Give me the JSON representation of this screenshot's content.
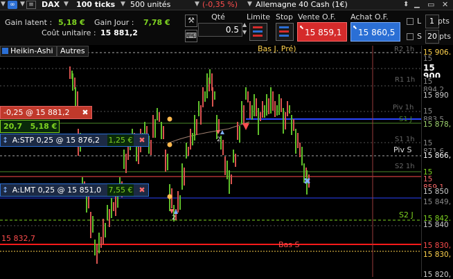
{
  "topbar": {
    "instrument": "DAX",
    "ticks": "100 ticks",
    "units": "500 unités",
    "change": "(-0,35 %)",
    "market": "Allemagne 40 Cash (1€)",
    "colors": {
      "change": "#ff4d4d"
    }
  },
  "info": {
    "gain_latent_label": "Gain latent :",
    "gain_latent_value": "5,18 €",
    "gain_jour_label": "Gain Jour :",
    "gain_jour_value": "7,78 €",
    "cout_label": "Coût unitaire :",
    "cout_value": "15 881,2"
  },
  "order": {
    "qte_label": "Qté",
    "qte_value": "0.5",
    "limite_label": "Limite",
    "stop_label": "Stop",
    "vente_label": "Vente O.F.",
    "vente_price": "15 859,1",
    "achat_label": "Achat O.F.",
    "achat_price": "15 860,5",
    "l_label": "L",
    "l_value": "1",
    "l_unit": "pts",
    "s_label": "S",
    "s_value": "20",
    "s_unit": "pts"
  },
  "chart_tabs": {
    "tab1": "Heikin-Ashi",
    "tab2": "Autres"
  },
  "position": {
    "label": "-0,25 @ 15 881,2",
    "qty": "20,7",
    "gain": "5,18 €"
  },
  "stop_order": {
    "label": "A:STP  0,25 @ 15 876,2",
    "value": "1,25 €"
  },
  "limit_order": {
    "label": "A:LMT  0,25 @ 15 851,0",
    "value": "7,55 €"
  },
  "annotations": {
    "bas_j_pre": "Bas J. Pré)",
    "bas": "Bas S",
    "price_left": "15 832,7",
    "piv_s": "Piv S",
    "s2_j": "S2 J",
    "marker_2a": "2",
    "marker_2b": "2"
  },
  "price_scale": [
    {
      "text": "15 906,",
      "color": "#ffd24d",
      "bg": "#000"
    },
    {
      "text": "15 906,1",
      "color": "#888",
      "bg": "#000"
    },
    {
      "text": "15 900",
      "color": "#fff",
      "bg": "#000"
    },
    {
      "text": "15 894,2",
      "color": "#888",
      "bg": "#000"
    },
    {
      "text": "15 890",
      "color": "#ccc",
      "bg": "#000"
    },
    {
      "text": "15 883,5",
      "color": "#888",
      "bg": "#000"
    },
    {
      "text": "15 878,",
      "color": "#9fd46e",
      "bg": "#000"
    },
    {
      "text": "15 871,6",
      "color": "#888",
      "bg": "#000"
    },
    {
      "text": "15 866,",
      "color": "#fff",
      "bg": "#000"
    },
    {
      "text": "15 860,5",
      "color": "#7ed321",
      "bg": "#000"
    },
    {
      "text": "15 859,1",
      "color": "#ff6b6b",
      "bg": "#000"
    },
    {
      "text": "15 850",
      "color": "#ccc",
      "bg": "#000"
    },
    {
      "text": "15 849,",
      "color": "#888",
      "bg": "#000"
    },
    {
      "text": "15 842,",
      "color": "#7ed321",
      "bg": "#000"
    },
    {
      "text": "15 840",
      "color": "#ccc",
      "bg": "#000"
    },
    {
      "text": "15 830,",
      "color": "#ff4d4d",
      "bg": "#000"
    },
    {
      "text": "15 830,",
      "color": "#ffd24d",
      "bg": "#000"
    },
    {
      "text": "15 820,",
      "color": "#ccc",
      "bg": "#000"
    }
  ],
  "level_labels": [
    {
      "text": "R2 1h"
    },
    {
      "text": "R1 1h"
    },
    {
      "text": "Piv 1h"
    },
    {
      "text": "S1 J"
    },
    {
      "text": "S1 1h"
    },
    {
      "text": "S2 1h"
    }
  ]
}
